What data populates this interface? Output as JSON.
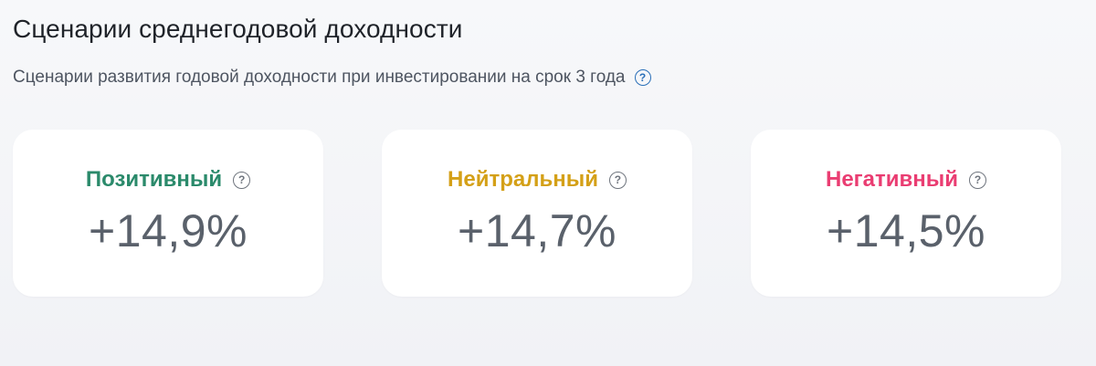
{
  "header": {
    "title": "Сценарии среднегодовой доходности",
    "subtitle": "Сценарии развития годовой доходности при инвестировании на срок 3 года",
    "help_icon": "question-circle-icon"
  },
  "scenarios": [
    {
      "label": "Позитивный",
      "value": "+14,9%",
      "color": "#2b8a6b",
      "help_icon": "question-circle-icon"
    },
    {
      "label": "Нейтральный",
      "value": "+14,7%",
      "color": "#d4a017",
      "help_icon": "question-circle-icon"
    },
    {
      "label": "Негативный",
      "value": "+14,5%",
      "color": "#ea3d72",
      "help_icon": "question-circle-icon"
    }
  ],
  "colors": {
    "accent_help": "#2a6fb8",
    "value_text": "#5a616b",
    "background": "#f3f4f7"
  }
}
